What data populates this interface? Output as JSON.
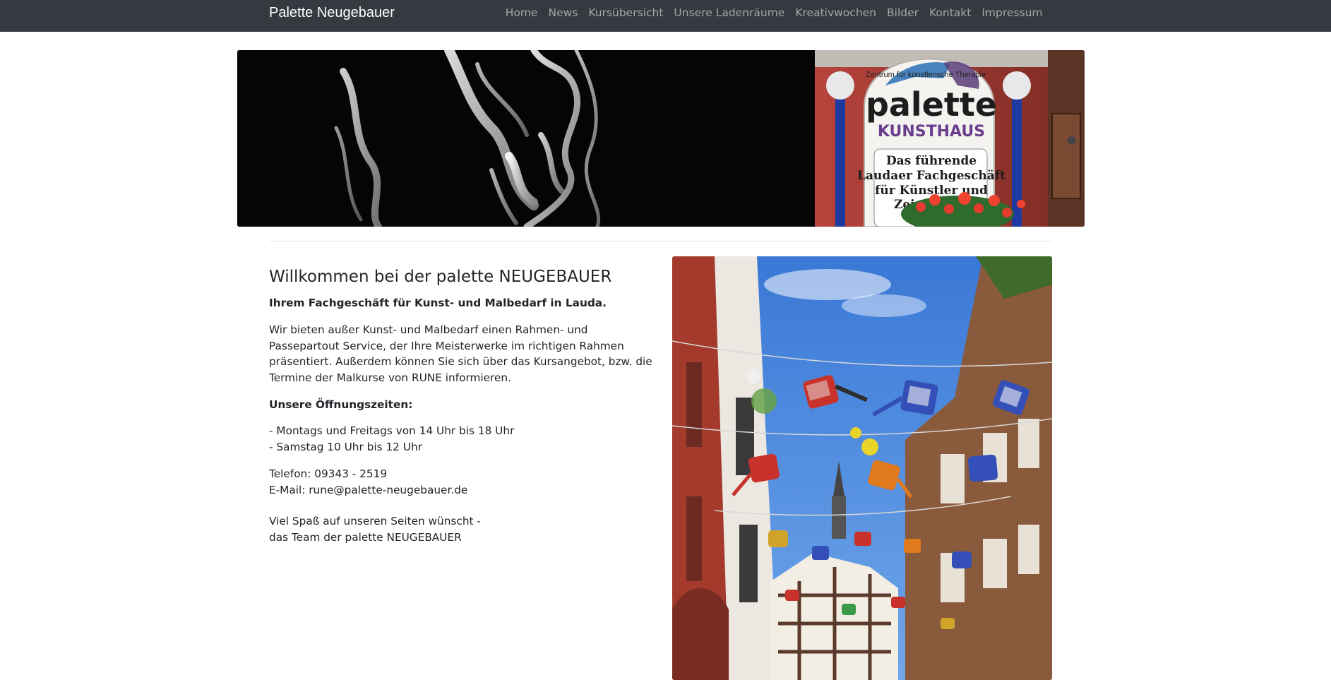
{
  "nav": {
    "brand": "Palette Neugebauer",
    "links": [
      {
        "label": "Home"
      },
      {
        "label": "News"
      },
      {
        "label": "Kursübersicht"
      },
      {
        "label": "Unsere Ladenräume"
      },
      {
        "label": "Kreativwochen"
      },
      {
        "label": "Bilder"
      },
      {
        "label": "Kontakt"
      },
      {
        "label": "Impressum"
      }
    ]
  },
  "banner": {
    "sign_arc_text": "Zentrum für künstlerische Therapie",
    "sign_logo": "palette",
    "sign_subtitle": "KUNSTHAUS",
    "sign_lines": [
      "Das führende",
      "Laudaer Fachgeschäft",
      "für Künstler und",
      "Zei"
    ]
  },
  "main": {
    "title": "Willkommen bei der palette NEUGEBAUER",
    "subtitle": "Ihrem Fachgeschäft für Kunst- und Malbedarf in Lauda.",
    "intro": "Wir bieten außer Kunst- und Malbedarf einen Rahmen- und Passepartout Service, der Ihre Meisterwerke im richtigen Rahmen präsentiert. Außerdem können Sie sich über das Kursangebot, bzw. die Termine der Malkurse von RUNE informieren.",
    "hours_title": "Unsere Öffnungszeiten:",
    "hours": [
      "- Montags und Freitags von 14 Uhr bis 18 Uhr",
      "- Samstag 10 Uhr bis 12 Uhr"
    ],
    "phone": "Telefon: 09343 - 2519",
    "email": "E-Mail: rune@palette-neugebauer.de",
    "closing": [
      "Viel Spaß auf unseren Seiten wünscht -",
      "das Team der palette NEUGEBAUER"
    ]
  },
  "colors": {
    "navbar_bg": "#343a40",
    "sky": "#3f7fd9",
    "brick": "#8a5a3c",
    "sign_purple": "#6a3d8f",
    "pole_blue": "#1c3aa0"
  }
}
